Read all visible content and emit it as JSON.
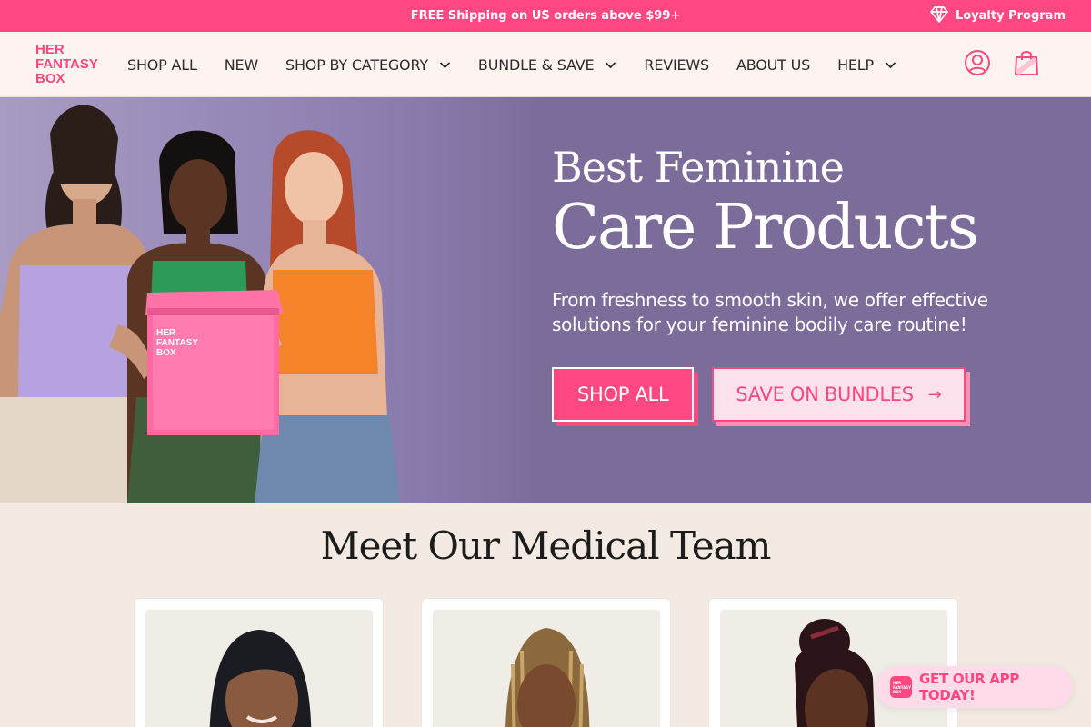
{
  "announcement": {
    "text": "FREE Shipping on US orders above $99+",
    "loyalty_label": "Loyalty Program",
    "loyalty_icon": "gem-icon",
    "bg_color": "#ff4781"
  },
  "header": {
    "logo_lines": [
      "HER",
      "FANTASY",
      "BOX"
    ],
    "nav": [
      {
        "label": "SHOP ALL",
        "dropdown": false
      },
      {
        "label": "NEW",
        "dropdown": false
      },
      {
        "label": "SHOP BY CATEGORY",
        "dropdown": true
      },
      {
        "label": "BUNDLE & SAVE",
        "dropdown": true
      },
      {
        "label": "REVIEWS",
        "dropdown": false
      },
      {
        "label": "ABOUT US",
        "dropdown": false
      },
      {
        "label": "HELP",
        "dropdown": true
      }
    ],
    "account_icon": "user-circle-icon",
    "cart_icon": "shopping-bag-icon"
  },
  "hero": {
    "eyebrow": "Best Feminine",
    "title": "Care Products",
    "subtitle": "From freshness to smooth skin, we offer effective solutions for your feminine bodily care routine!",
    "primary_button": "SHOP ALL",
    "secondary_button": "SAVE ON BUNDLES",
    "secondary_arrow": "→",
    "box_label_lines": [
      "HER",
      "FANTASY",
      "BOX"
    ],
    "bg_color": "#7b6c9a"
  },
  "medical": {
    "title": "Meet Our Medical Team"
  },
  "app_badge": {
    "icon_lines": [
      "HER",
      "FANTASY",
      "BOX"
    ],
    "label": "GET OUR APP TODAY!"
  },
  "colors": {
    "accent": "#ff4781",
    "header_bg": "#fdf4f1",
    "page_bg": "#f3ebe3"
  }
}
